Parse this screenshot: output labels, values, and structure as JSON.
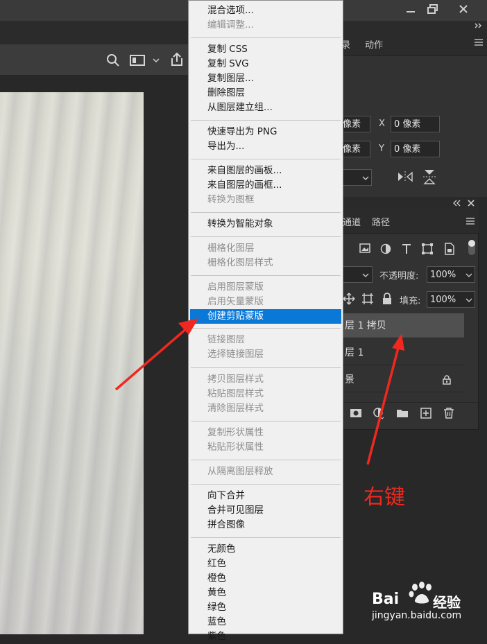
{
  "context_menu": {
    "items": [
      {
        "label": "混合选项...",
        "enabled": true
      },
      {
        "label": "编辑调整...",
        "enabled": false
      },
      {
        "label": "复制 CSS",
        "enabled": true
      },
      {
        "label": "复制 SVG",
        "enabled": true
      },
      {
        "label": "复制图层...",
        "enabled": true
      },
      {
        "label": "删除图层",
        "enabled": true
      },
      {
        "label": "从图层建立组...",
        "enabled": true
      },
      {
        "label": "快速导出为 PNG",
        "enabled": true
      },
      {
        "label": "导出为...",
        "enabled": true
      },
      {
        "label": "来自图层的画板...",
        "enabled": true
      },
      {
        "label": "来自图层的画框...",
        "enabled": true
      },
      {
        "label": "转换为图框",
        "enabled": false
      },
      {
        "label": "转换为智能对象",
        "enabled": true
      },
      {
        "label": "栅格化图层",
        "enabled": false
      },
      {
        "label": "栅格化图层样式",
        "enabled": false
      },
      {
        "label": "启用图层蒙版",
        "enabled": false
      },
      {
        "label": "启用矢量蒙版",
        "enabled": false
      },
      {
        "label": "创建剪贴蒙版",
        "enabled": true,
        "highlighted": true
      },
      {
        "label": "链接图层",
        "enabled": false
      },
      {
        "label": "选择链接图层",
        "enabled": false
      },
      {
        "label": "拷贝图层样式",
        "enabled": false
      },
      {
        "label": "粘贴图层样式",
        "enabled": false
      },
      {
        "label": "清除图层样式",
        "enabled": false
      },
      {
        "label": "复制形状属性",
        "enabled": false
      },
      {
        "label": "粘贴形状属性",
        "enabled": false
      },
      {
        "label": "从隔离图层释放",
        "enabled": false
      },
      {
        "label": "向下合并",
        "enabled": true
      },
      {
        "label": "合并可见图层",
        "enabled": true
      },
      {
        "label": "拼合图像",
        "enabled": true
      },
      {
        "label": "无颜色",
        "enabled": true
      },
      {
        "label": "红色",
        "enabled": true
      },
      {
        "label": "橙色",
        "enabled": true
      },
      {
        "label": "黄色",
        "enabled": true
      },
      {
        "label": "绿色",
        "enabled": true
      },
      {
        "label": "蓝色",
        "enabled": true
      },
      {
        "label": "紫色",
        "enabled": true
      }
    ]
  },
  "top_panel": {
    "tabs": [
      "录",
      "动作"
    ],
    "w_value": "像素",
    "h_value": "像素",
    "x_label": "X",
    "x_value": "0 像素",
    "y_label": "Y",
    "y_value": "0 像素"
  },
  "layers_panel": {
    "tabs": [
      "通道",
      "路径"
    ],
    "opacity_label": "不透明度:",
    "opacity_value": "100%",
    "fill_label": "填充:",
    "fill_value": "100%",
    "layers": [
      "层 1 拷贝",
      "层 1",
      "景"
    ]
  },
  "annotation": {
    "text": "右键",
    "color": "#f0281f"
  },
  "watermark": {
    "brand_left": "Bai",
    "brand_right": "经验",
    "url": "jingyan.baidu.com"
  },
  "colors": {
    "highlight": "#0a78d7",
    "menu_bg": "#f0f0f0",
    "arrow": "#f0281f"
  }
}
